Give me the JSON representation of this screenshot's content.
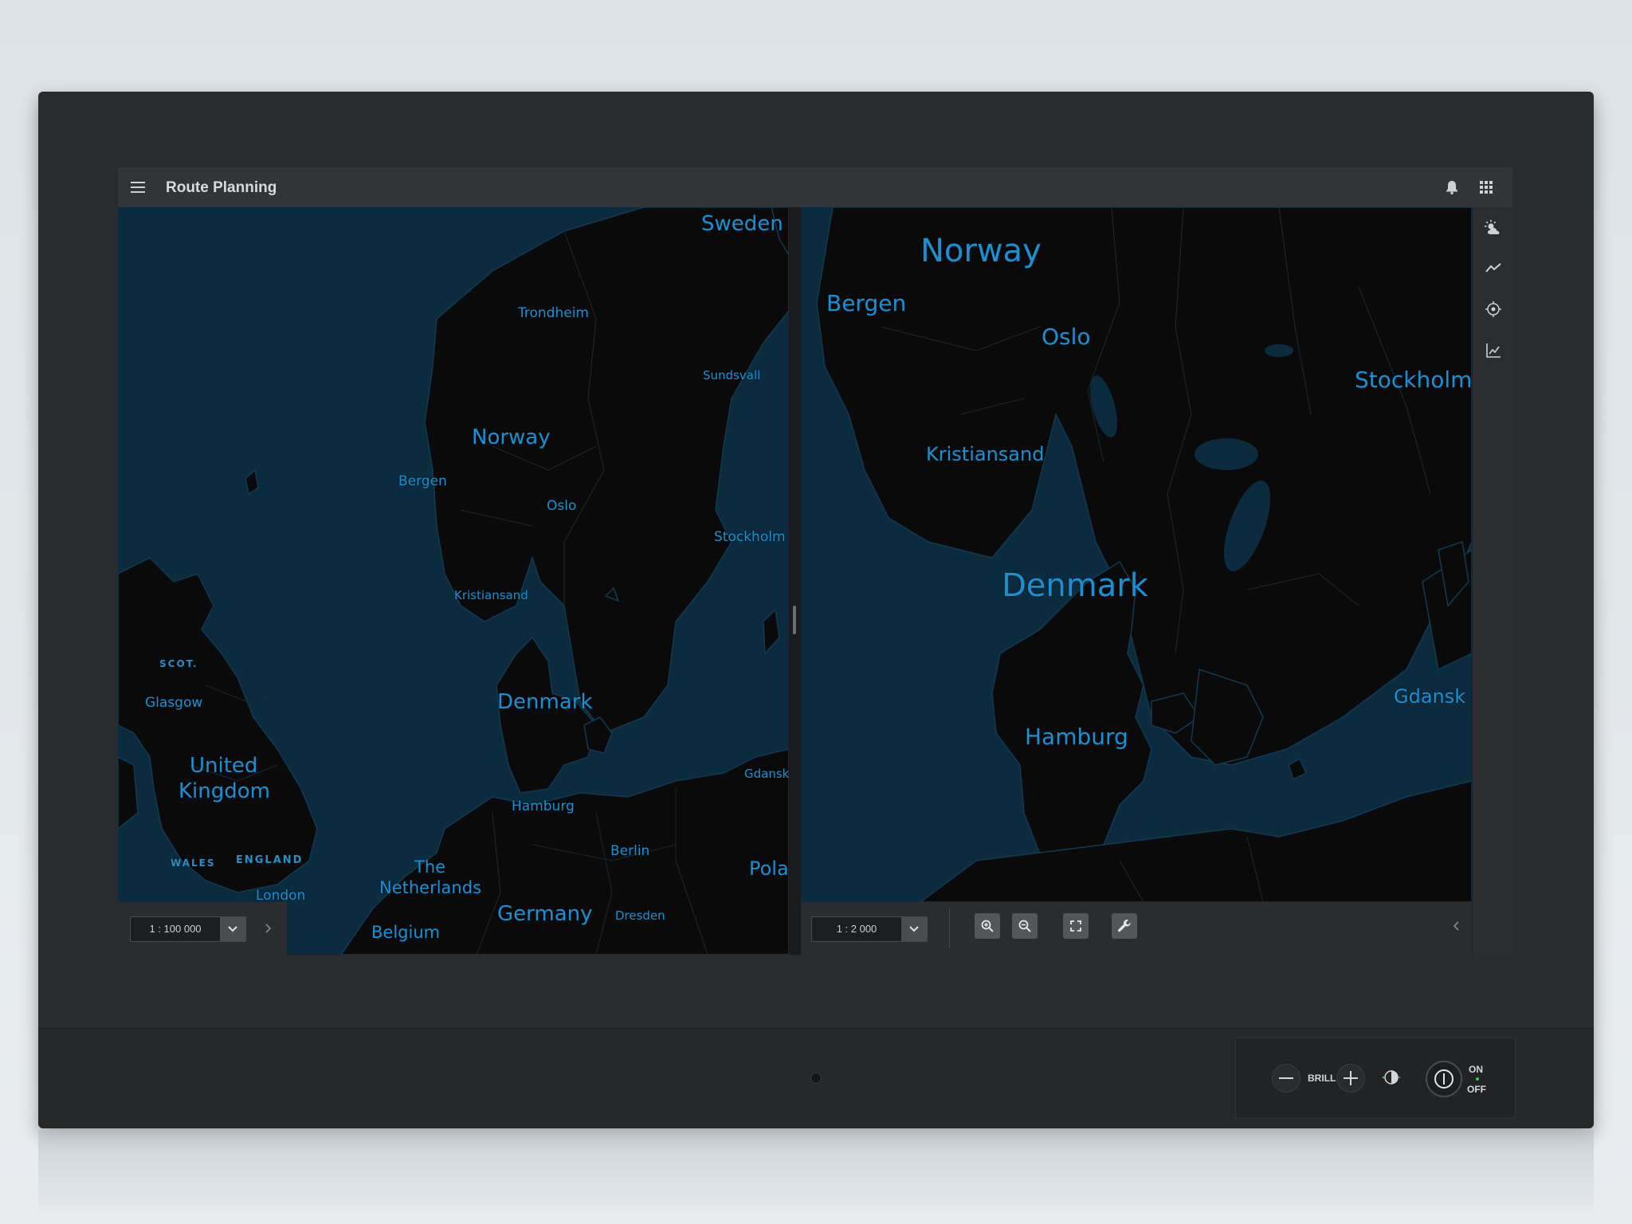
{
  "app": {
    "title": "Route Planning"
  },
  "left_map": {
    "scale": "1 : 100 000",
    "labels": {
      "sweden": "Sweden",
      "trondheim": "Trondheim",
      "sundsvall": "Sundsvall",
      "norway": "Norway",
      "bergen": "Bergen",
      "oslo": "Oslo",
      "stockholm": "Stockholm",
      "kristiansand": "Kristiansand",
      "scot": "SCOT.",
      "glasgow": "Glasgow",
      "denmark": "Denmark",
      "united_kingdom_1": "United",
      "united_kingdom_2": "Kingdom",
      "gdansk": "Gdansk",
      "hamburg": "Hamburg",
      "wales": "WALES",
      "england": "ENGLAND",
      "berlin": "Berlin",
      "the_netherlands_1": "The",
      "the_netherlands_2": "Netherlands",
      "pola": "Pola",
      "london": "London",
      "germany": "Germany",
      "dresden": "Dresden",
      "belgium": "Belgium"
    }
  },
  "right_map": {
    "scale": "1 : 2 000",
    "labels": {
      "norway": "Norway",
      "bergen": "Bergen",
      "oslo": "Oslo",
      "stockholm": "Stockholm",
      "kristiansand": "Kristiansand",
      "denmark": "Denmark",
      "gdansk": "Gdansk",
      "hamburg": "Hamburg"
    }
  },
  "hardware": {
    "brill_label": "BRILL",
    "on_label": "ON",
    "off_label": "OFF"
  },
  "icons": {
    "menu": "menu-icon",
    "notifications": "bell-icon",
    "apps": "grid-icon",
    "weather": "weather-icon",
    "trend": "trend-icon",
    "target": "target-icon",
    "chart": "chart-icon",
    "zoom_in": "zoom-in-icon",
    "zoom_out": "zoom-out-icon",
    "fit": "fit-screen-icon",
    "tools": "wrench-icon"
  },
  "colors": {
    "water": "#0b2b3f",
    "land": "#0b0b0c",
    "label": "#1d8fcf",
    "appbar": "#333436"
  }
}
